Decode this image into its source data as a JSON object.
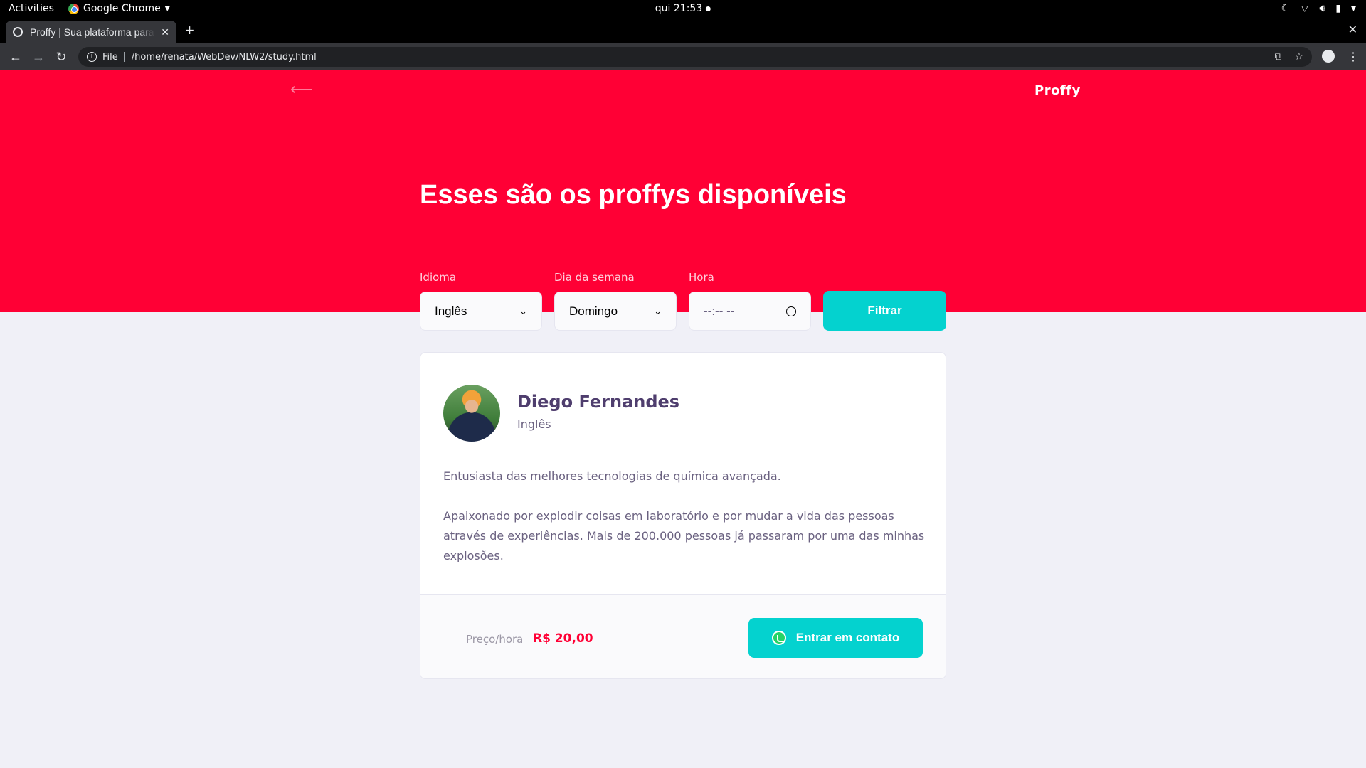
{
  "system": {
    "activities": "Activities",
    "app_name": "Google Chrome",
    "clock": "qui 21:53"
  },
  "browser": {
    "tab_title": "Proffy | Sua plataforma para estudos online",
    "scheme_label": "File",
    "url": "/home/renata/WebDev/NLW2/study.html"
  },
  "page": {
    "logo": "Proffy",
    "headline": "Esses são os proffys disponíveis",
    "filters": {
      "subject_label": "Idioma",
      "subject_value": "Inglês",
      "weekday_label": "Dia da semana",
      "weekday_value": "Domingo",
      "time_label": "Hora",
      "time_placeholder": "--:-- --",
      "button": "Filtrar"
    },
    "teacher": {
      "name": "Diego Fernandes",
      "subject": "Inglês",
      "bio_1": "Entusiasta das melhores tecnologias de química avançada.",
      "bio_2": "Apaixonado por explodir coisas em laboratório e por mudar a vida das pessoas através de experiências. Mais de 200.000 pessoas já passaram por uma das minhas explosões.",
      "price_label": "Preço/hora",
      "price": "R$ 20,00",
      "contact_button": "Entrar em contato"
    }
  },
  "colors": {
    "brand_primary": "#ff0035",
    "secondary": "#04d2cf",
    "background": "#f0f0f7",
    "title_text": "#4f3e6e"
  }
}
